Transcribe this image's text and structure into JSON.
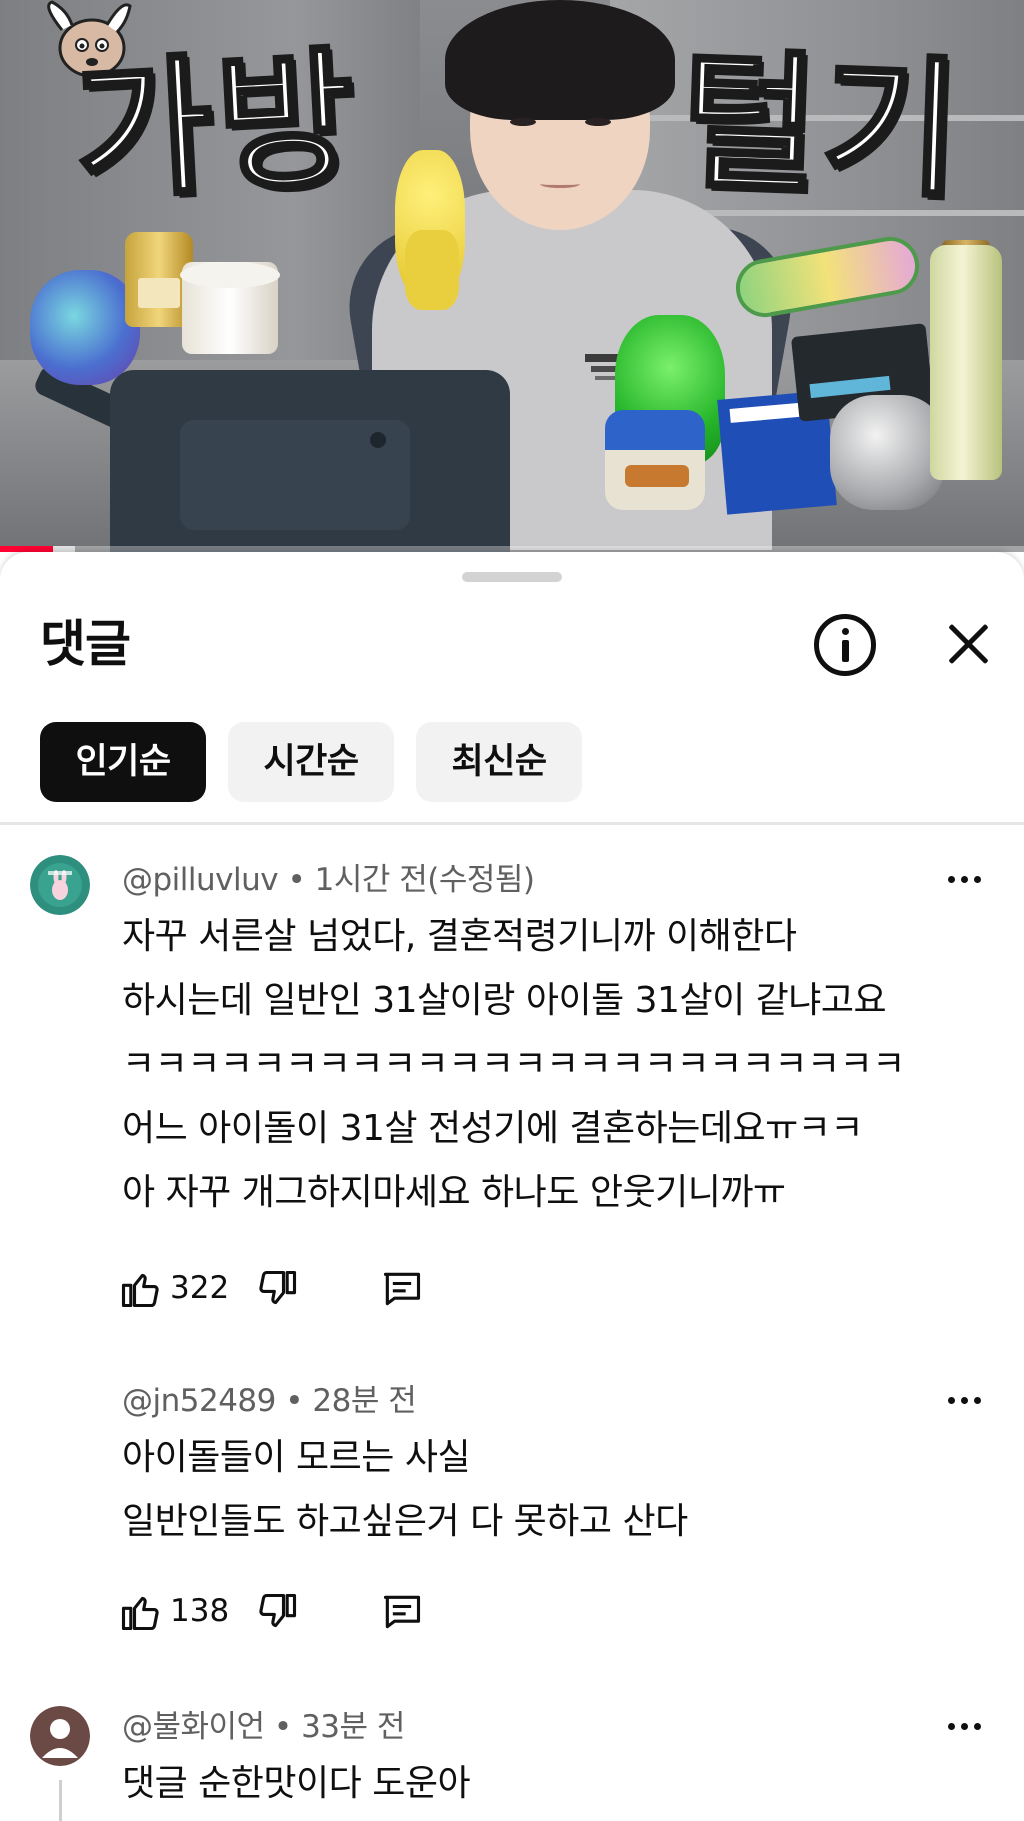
{
  "video": {
    "title_overlay_left": "가방",
    "title_overlay_right": "털기",
    "progress_played_fraction": 0.052,
    "progress_buffered_fraction": 0.073,
    "progress_color": "#ff0033"
  },
  "sheet": {
    "title": "댓글",
    "info_icon": "info-icon",
    "close_icon": "close-icon"
  },
  "sort_chips": [
    {
      "label": "인기순",
      "active": true
    },
    {
      "label": "시간순",
      "active": false
    },
    {
      "label": "최신순",
      "active": false
    }
  ],
  "comments": [
    {
      "author": "@pilluvluv",
      "time": "1시간 전(수정됨)",
      "meta": "@pilluvluv • 1시간 전(수정됨)",
      "body": "자꾸 서른살 넘었다, 결혼적령기니까 이해한다\n하시는데 일반인 31살이랑 아이돌 31살이 같냐고요\nㅋㅋㅋㅋㅋㅋㅋㅋㅋㅋㅋㅋㅋㅋㅋㅋㅋㅋㅋㅋㅋㅋㅋㅋ\n어느 아이돌이 31살 전성기에 결혼하는데요ㅠㅋㅋ\n아 자꾸 개그하지마세요 하나도 안웃기니까ㅠ",
      "likes": "322",
      "avatar_color": "#2f8f7f"
    },
    {
      "author": "@jn52489",
      "time": "28분 전",
      "meta": "@jn52489 • 28분 전",
      "body": "아이돌들이 모르는 사실\n일반인들도 하고싶은거 다 못하고 산다",
      "likes": "138",
      "avatar_color": ""
    },
    {
      "author": "@불화이언",
      "time": "33분 전",
      "meta": "@불화이언 • 33분 전",
      "body": "댓글 순한맛이다 도운아",
      "likes": "",
      "avatar_color": "#6b4a45"
    }
  ],
  "icons": {
    "like": "thumbs-up-icon",
    "dislike": "thumbs-down-icon",
    "reply": "reply-icon",
    "more": "more-vert-icon"
  }
}
